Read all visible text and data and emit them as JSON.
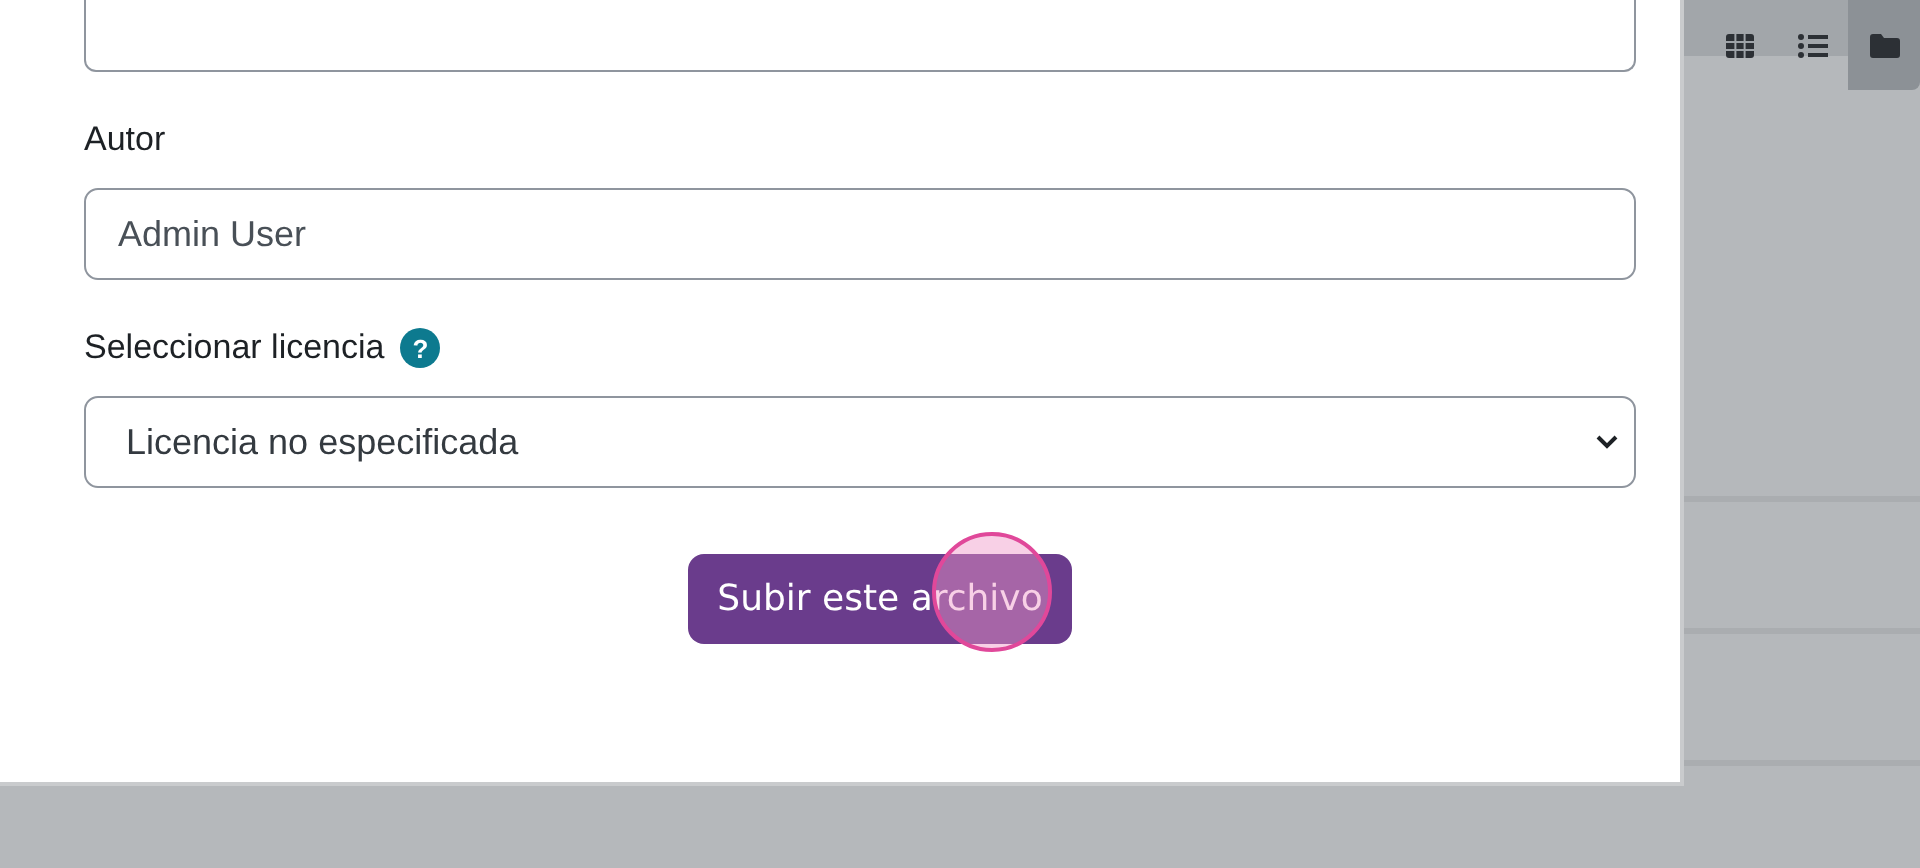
{
  "view_buttons": [
    {
      "kind": "grid",
      "selected": false
    },
    {
      "kind": "list",
      "selected": false
    },
    {
      "kind": "folder",
      "selected": true
    }
  ],
  "form": {
    "author": {
      "label": "Autor",
      "value": "Admin User"
    },
    "license": {
      "label": "Seleccionar licencia",
      "help": "?",
      "value": "Licencia no especificada"
    },
    "submit": "Subir este archivo",
    "click_marker": true
  }
}
